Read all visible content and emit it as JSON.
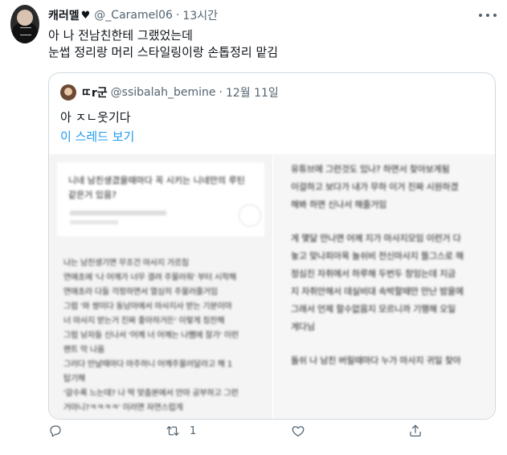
{
  "tweet": {
    "display_name": "캐러멜",
    "handle": "@_Caramel06",
    "separator": "·",
    "time": "13시간",
    "text_lines": [
      "아 나 전남친한테 그랬었는데",
      "눈썹 정리랑 머리 스타일링이랑 손톱정리 맡김"
    ],
    "icons": {
      "after_name": "heart-icon",
      "more": "more-icon"
    }
  },
  "quote": {
    "display_name": "ㄸr군",
    "handle": "@ssibalah_bemine",
    "separator": "·",
    "time": "12월 11일",
    "text": "아 ㅈㄴ웃기다",
    "thread_link": "이 스레드 보기",
    "image_left": {
      "title_lines": [
        "니네 남친생겼을때마다 꼭 시키는 니네만의 루틴",
        "같은거 있음?"
      ],
      "body_lines": [
        "나는 남친생기면 무조건 마사지 가르침",
        "연애초에 '나 어깨가 너무 결려 주물러줘' 부터 시작해",
        "연애초라 다들 걱정하면서 열심히 주물러줄거임",
        "그럼 '와 쌍미다 동남아에서 마사지사 받는 기분이야",
        "너 마사지 받는거 진짜 좋아하거든' 이렇게 칭찬해",
        "그럼 낭자들 신나서 '어께 너 어께는 나쨈에 잘가' 이런",
        "팬트 막 나옴",
        "그러다 만날때마다 마주하니 어깨주물러달라고 해 1",
        "탑기해",
        "'갈수록 느는데? 나 딱 맞춤본에서 안마 공부하고 그런",
        "거아니?ㅋㅋㅋㅋ' 이러면 자연스럽게"
      ]
    },
    "image_right": {
      "lines": [
        "유튜브에 그런것도 있나? 하면서 찾아보게됨",
        "이걸하고 보다가 내가 무하 이거 진짜 시원하겠",
        "해봐 하면 신나서 해줄거임",
        "",
        "게 몇달 만나면 어께 지가 마사지모임 이런거 다",
        "놓고 맞나피아목 놀쉬비 전신마사지 뜰그스로 해",
        "정심진 자취에서 하루해 두번두 창잉는데 지금",
        "지 자취안해서 데실비대 속박할때만 만난 밤을에",
        "그래서 언제 할수없음지 모르니까 기행해 오일",
        "게다님",
        "",
        "돌쉬 나 남친 버릴때마다 누가 마사지 귀일 찾아"
      ]
    }
  },
  "actions": {
    "reply_icon": "reply-icon",
    "retweet_icon": "retweet-icon",
    "retweet_count": "1",
    "like_icon": "like-icon",
    "share_icon": "share-icon"
  }
}
